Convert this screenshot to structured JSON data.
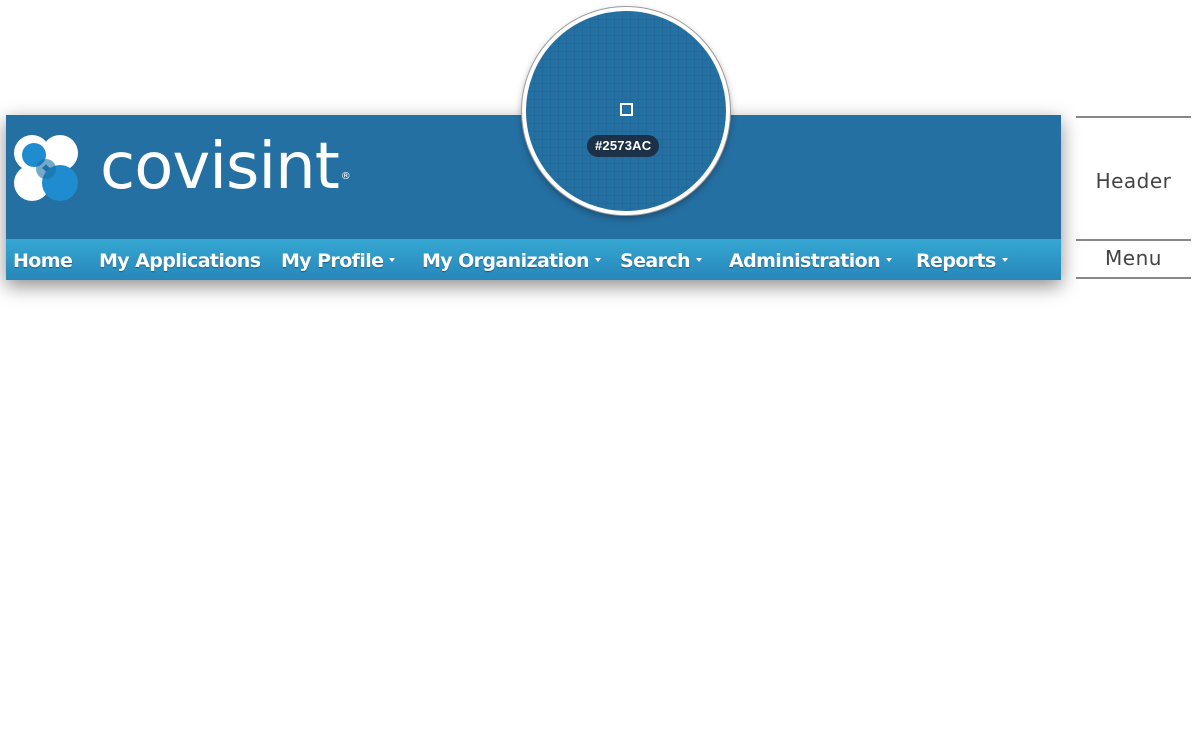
{
  "header": {
    "brand": "covisint",
    "registered_mark": "®",
    "background_color": "#2570A3",
    "logo_icon": "covisint-logo-icon"
  },
  "menu": {
    "items": [
      {
        "label": "Home",
        "dropdown": false
      },
      {
        "label": "My Applications",
        "dropdown": false
      },
      {
        "label": "My Profile",
        "dropdown": true
      },
      {
        "label": "My Organization",
        "dropdown": true
      },
      {
        "label": "Search",
        "dropdown": true
      },
      {
        "label": "Administration",
        "dropdown": true
      },
      {
        "label": "Reports",
        "dropdown": true
      }
    ],
    "background_color": "#2D93C4"
  },
  "color_picker": {
    "hex_label": "#2573AC",
    "sampled_color": "#2573AC"
  },
  "annotations": {
    "header_label": "Header",
    "menu_label": "Menu"
  }
}
